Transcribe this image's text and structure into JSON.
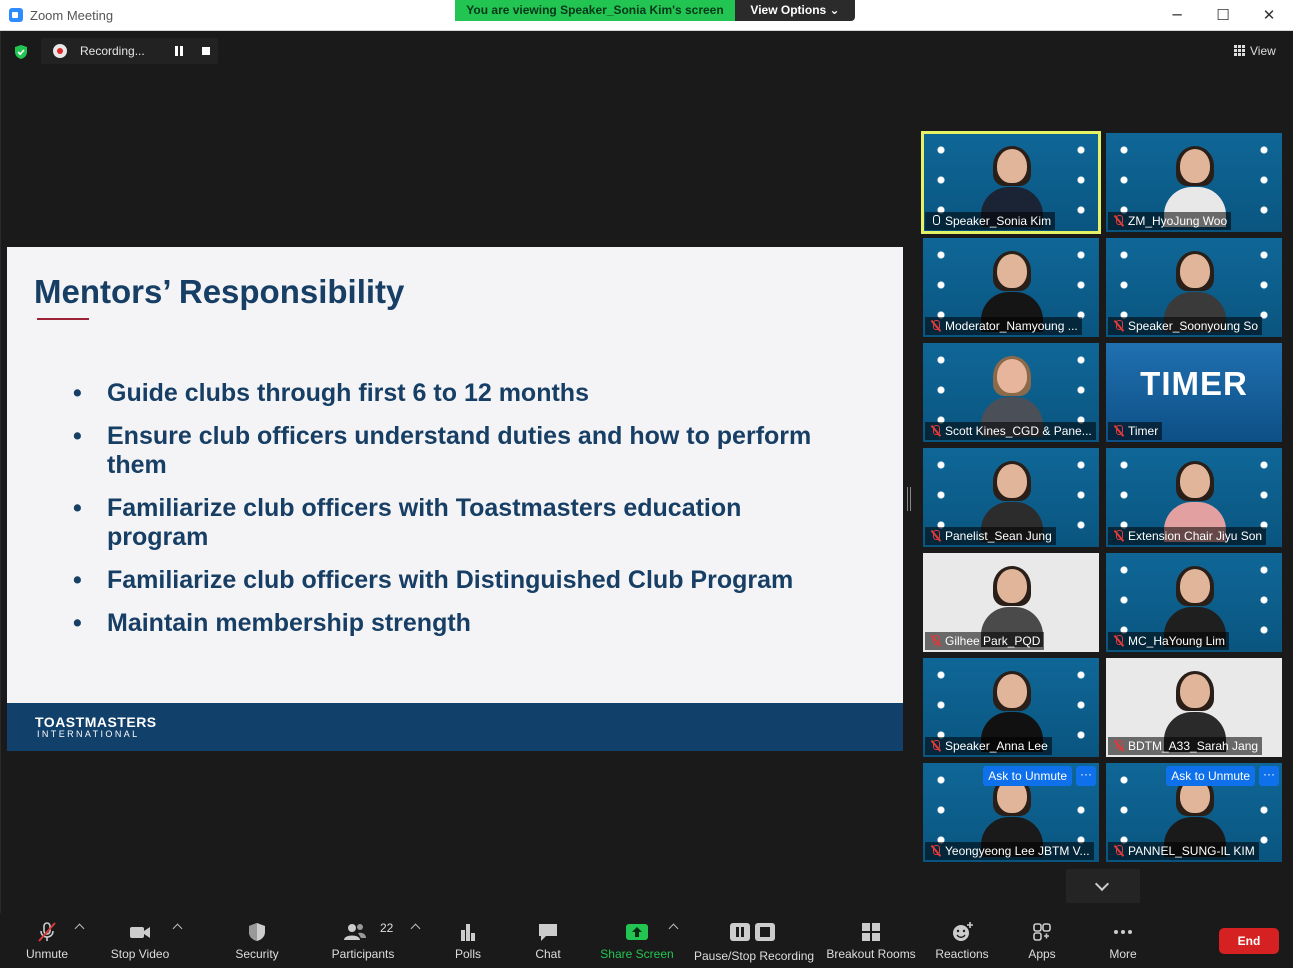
{
  "window": {
    "title": "Zoom Meeting",
    "minimize": "─",
    "maximize": "☐",
    "close": "✕"
  },
  "banner": {
    "viewing": "You are viewing Speaker_Sonia Kim's screen",
    "view_options": "View Options ⌄"
  },
  "recording": {
    "label": "Recording..."
  },
  "view_button": {
    "label": "View"
  },
  "slide": {
    "title": "Mentors’ Responsibility",
    "bullets": [
      "Guide clubs through first 6 to 12 months",
      "Ensure club officers understand duties and how to perform them",
      "Familiarize club officers with Toastmasters education program",
      "Familiarize club officers with Distinguished Club Program",
      "Maintain membership strength"
    ],
    "logo_main": "TOASTMASTERS",
    "logo_sub": "INTERNATIONAL"
  },
  "participants": [
    {
      "name": "Speaker_Sonia Kim",
      "active": true,
      "muted": false
    },
    {
      "name": "ZM_HyoJung Woo",
      "muted": true
    },
    {
      "name": "Moderator_Namyoung ...",
      "muted": true
    },
    {
      "name": "Speaker_Soonyoung So",
      "muted": true
    },
    {
      "name": "Scott Kines_CGD & Pane...",
      "muted": true
    },
    {
      "name": "Timer",
      "muted": true,
      "timer_text": "TIMER"
    },
    {
      "name": "Panelist_Sean Jung",
      "muted": true
    },
    {
      "name": "Extension Chair Jiyu Son",
      "muted": true
    },
    {
      "name": "Gilhee Park_PQD",
      "muted": true
    },
    {
      "name": "MC_HaYoung Lim",
      "muted": true
    },
    {
      "name": "Speaker_Anna Lee",
      "muted": true
    },
    {
      "name": "BDTM_A33_Sarah Jang",
      "muted": true
    },
    {
      "name": "Yeongyeong Lee JBTM V...",
      "muted": true,
      "ask_label": "Ask to Unmute",
      "more_label": "···"
    },
    {
      "name": "PANNEL_SUNG-IL KIM",
      "muted": true,
      "ask_label": "Ask to Unmute",
      "more_label": "···"
    }
  ],
  "toolbar": {
    "unmute": "Unmute",
    "stop_video": "Stop Video",
    "security": "Security",
    "participants": "Participants",
    "participants_count": "22",
    "polls": "Polls",
    "chat": "Chat",
    "share_screen": "Share Screen",
    "pause_stop_recording": "Pause/Stop Recording",
    "breakout_rooms": "Breakout Rooms",
    "reactions": "Reactions",
    "apps": "Apps",
    "more": "More",
    "end": "End"
  },
  "colors": {
    "share_green": "#23c552",
    "end_red": "#d52121",
    "slide_navy": "#173e64",
    "active_speaker": "#e6f266"
  }
}
